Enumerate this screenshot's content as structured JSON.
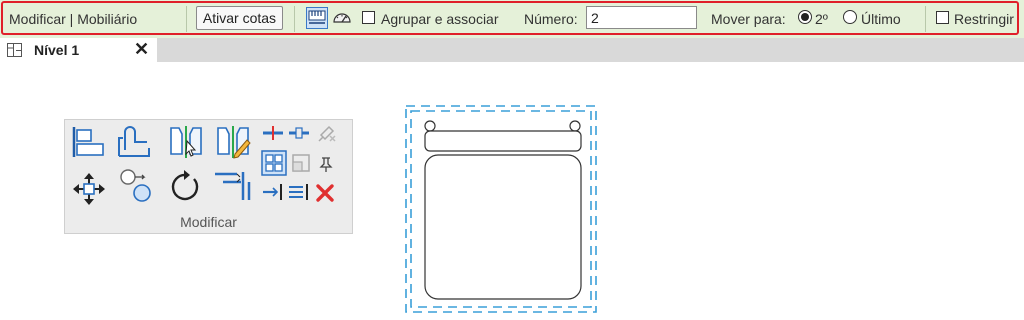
{
  "options_bar": {
    "context_label": "Modificar | Mobiliário",
    "ativar_cotas_label": "Ativar cotas",
    "agrupar_label": "Agrupar e associar",
    "agrupar_checked": false,
    "numero_label": "Número:",
    "numero_value": "2",
    "mover_para_label": "Mover para:",
    "option_segundo": "2º",
    "option_ultimo": "Último",
    "mover_para_selected": "2º",
    "restringir_label": "Restringir",
    "restringir_checked": false,
    "highlight_color": "#e0202a"
  },
  "tab": {
    "title": "Nível 1",
    "close_glyph": "✕",
    "icon": "floor-plan-view-icon"
  },
  "ribbon_panel": {
    "title": "Modificar",
    "tools": [
      "align-icon",
      "offset-icon",
      "mirror-pick-axis-icon",
      "mirror-draw-axis-icon",
      "split-element-icon",
      "split-with-gap-icon",
      "unpin-icon",
      "move-icon",
      "copy-icon",
      "rotate-icon",
      "trim-extend-corner-icon",
      "array-icon",
      "scale-icon",
      "pin-icon",
      "trim-extend-single-icon",
      "trim-extend-multiple-icon",
      "delete-icon"
    ]
  },
  "colors": {
    "options_bar_bg": "#e5f1d9",
    "selection_blue": "#3a9fd8",
    "delete_red": "#e03030"
  }
}
